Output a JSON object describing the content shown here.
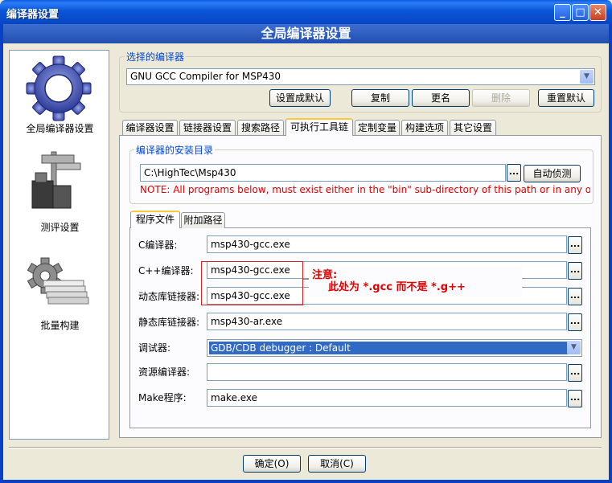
{
  "window": {
    "title": "编译器设置",
    "controls": {
      "minimize": "_",
      "maximize": "□",
      "close": "✕"
    }
  },
  "header": {
    "title": "全局编译器设置"
  },
  "sidebar": {
    "items": [
      {
        "label": "全局编译器设置",
        "icon": "gear-icon"
      },
      {
        "label": "测评设置",
        "icon": "caliper-icon"
      },
      {
        "label": "批量构建",
        "icon": "batch-build-icon"
      }
    ]
  },
  "compiler_select": {
    "group_title": "选择的编译器",
    "value": "GNU GCC Compiler for MSP430",
    "buttons": {
      "set_default": "设置成默认",
      "copy": "复制",
      "rename": "更名",
      "delete": "删除",
      "reset": "重置默认"
    }
  },
  "tabs": [
    "编译器设置",
    "链接器设置",
    "搜索路径",
    "可执行工具链",
    "定制变量",
    "构建选项",
    "其它设置"
  ],
  "install_dir": {
    "group_title": "编译器的安装目录",
    "value": "C:\\HighTec\\Msp430",
    "browse": "...",
    "auto_detect": "自动侦测",
    "note": "NOTE: All programs below, must exist either in the \"bin\" sub-directory of this path or in any of the"
  },
  "subtabs": [
    "程序文件",
    "附加路径"
  ],
  "programs": [
    {
      "label": "C编译器:",
      "value": "msp430-gcc.exe",
      "type": "text"
    },
    {
      "label": "C++编译器:",
      "value": "msp430-gcc.exe",
      "type": "text"
    },
    {
      "label": "动态库链接器:",
      "value": "msp430-gcc.exe",
      "type": "text"
    },
    {
      "label": "静态库链接器:",
      "value": "msp430-ar.exe",
      "type": "text"
    },
    {
      "label": "调试器:",
      "value": "GDB/CDB debugger : Default",
      "type": "select"
    },
    {
      "label": "资源编译器:",
      "value": "",
      "type": "text"
    },
    {
      "label": "Make程序:",
      "value": "make.exe",
      "type": "text"
    }
  ],
  "annotation": {
    "line1": "注意:",
    "line2": "此处为 *.gcc 而不是 *.g++"
  },
  "footer": {
    "ok": "确定(O)",
    "cancel": "取消(C)"
  },
  "colors": {
    "accent_red": "#e00000",
    "title_blue": "#0a55d8",
    "selection_blue": "#316ac5"
  }
}
